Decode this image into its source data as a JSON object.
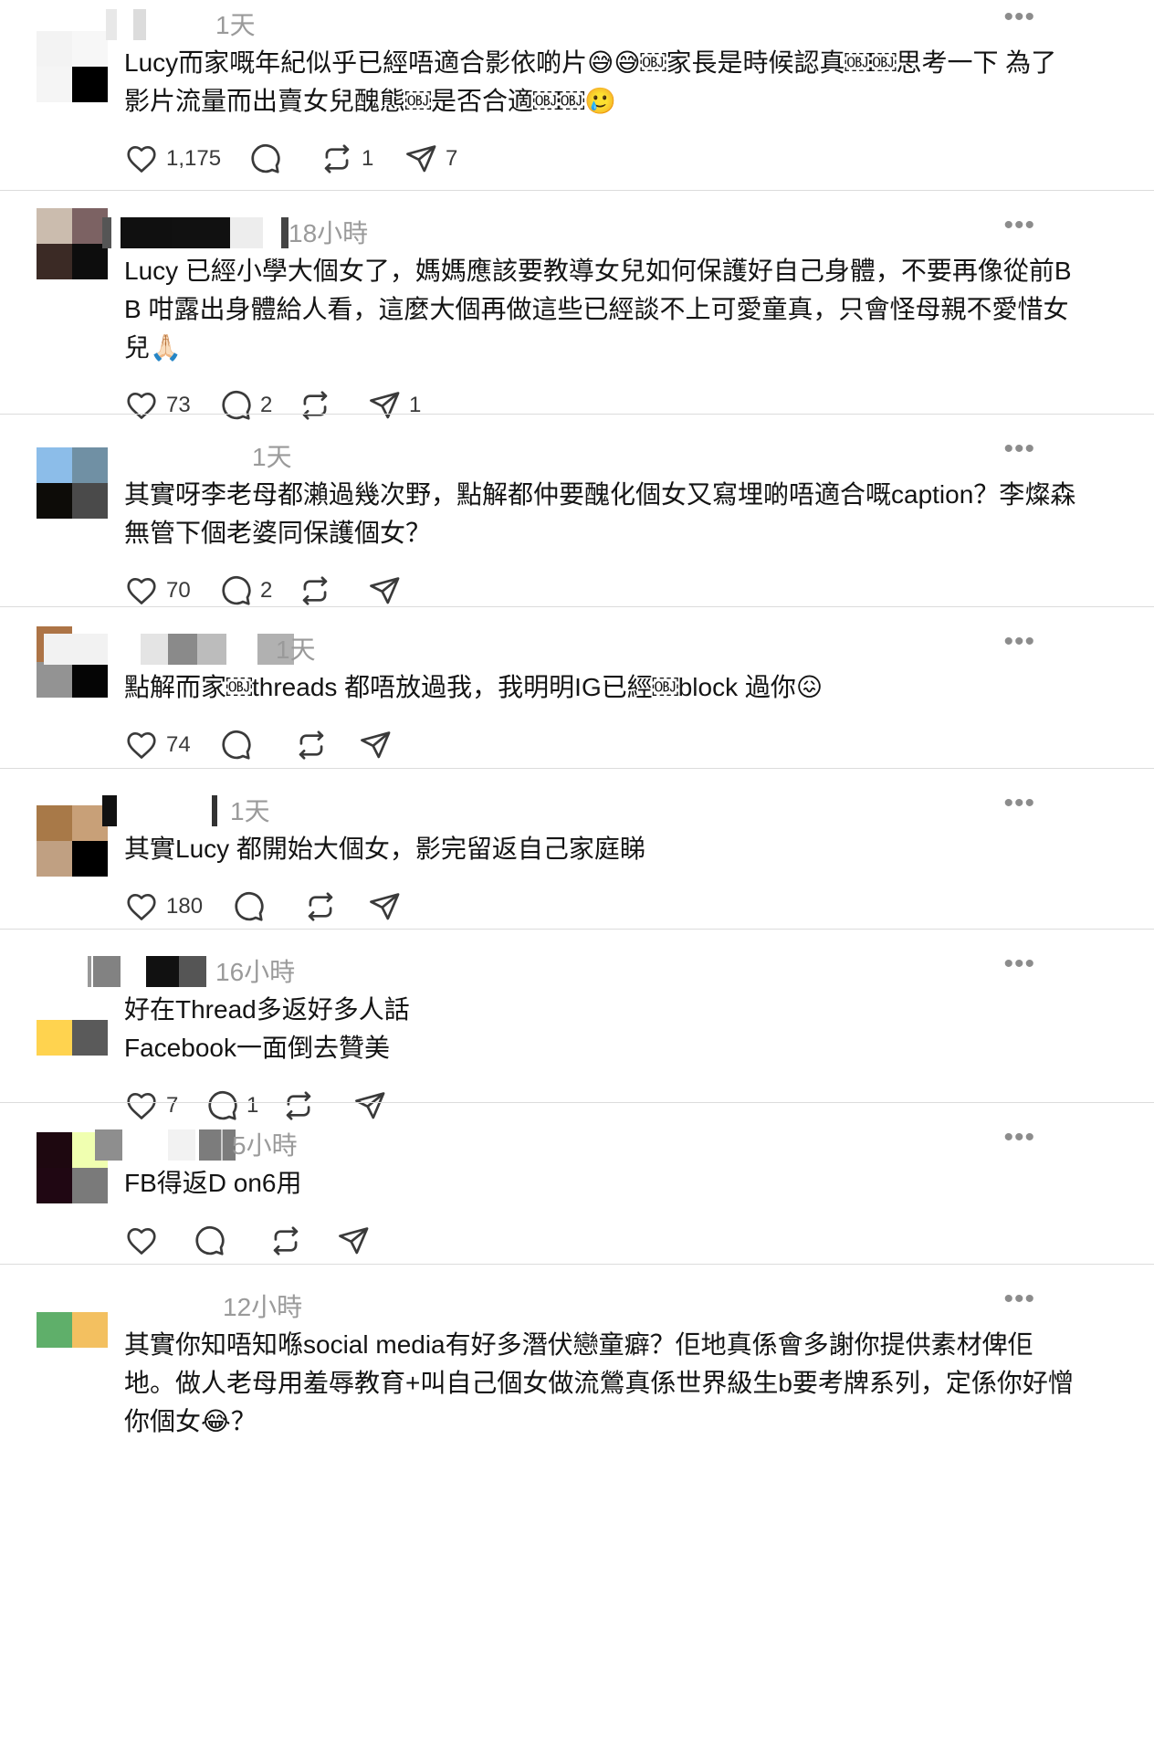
{
  "comments": [
    {
      "time": "1天",
      "text": "Lucy而家嘅年紀似乎已經唔適合影依啲片😅😅￼家長是時候認真￼￼思考一下 為了影片流量而出賣女兒醜態￼是否合適￼￼🥲",
      "likes": "1,175",
      "replies": "",
      "reposts": "1",
      "shares": "7"
    },
    {
      "time": "18小時",
      "text": "Lucy 已經小學大個女了，媽媽應該要教導女兒如何保護好自己身體，不要再像從前BB 咁露出身體給人看，這麼大個再做這些已經談不上可愛童真，只會怪母親不愛惜女兒🙏🏻",
      "likes": "73",
      "replies": "2",
      "reposts": "",
      "shares": "1"
    },
    {
      "time": "1天",
      "text": "其實呀李老母都瀨過幾次野，點解都仲要醜化個女又寫埋啲唔適合嘅caption？李燦森無管下個老婆同保護個女？",
      "likes": "70",
      "replies": "2",
      "reposts": "",
      "shares": ""
    },
    {
      "time": "1天",
      "text": "點解而家￼threads 都唔放過我，我明明IG已經￼block 過你😖",
      "likes": "74",
      "replies": "",
      "reposts": "",
      "shares": ""
    },
    {
      "time": "1天",
      "text": "其實Lucy 都開始大個女，影完留返自己家庭睇",
      "likes": "180",
      "replies": "",
      "reposts": "",
      "shares": ""
    },
    {
      "time": "16小時",
      "text": "好在Thread多返好多人話\nFacebook一面倒去贊美",
      "likes": "7",
      "replies": "1",
      "reposts": "",
      "shares": ""
    },
    {
      "time": "5小時",
      "text": "FB得返D on6用",
      "likes": "",
      "replies": "",
      "reposts": "",
      "shares": ""
    },
    {
      "time": "12小時",
      "text": "其實你知唔知喺social media有好多潛伏戀童癖？佢地真係會多謝你提供素材俾佢地。做人老母用羞辱教育+叫自己個女做流鶯真係世界級生b要考牌系列，定係你好憎你個女😂？",
      "likes": "",
      "replies": "",
      "reposts": "",
      "shares": ""
    }
  ],
  "colors": {
    "background": "#ffffff",
    "text": "#141414",
    "timestamp": "#9a9a9a",
    "icon": "#3a3a3a",
    "divider": "#dcdcdc"
  },
  "icons": [
    "heart-icon",
    "reply-icon",
    "repost-icon",
    "share-icon",
    "more-icon"
  ]
}
